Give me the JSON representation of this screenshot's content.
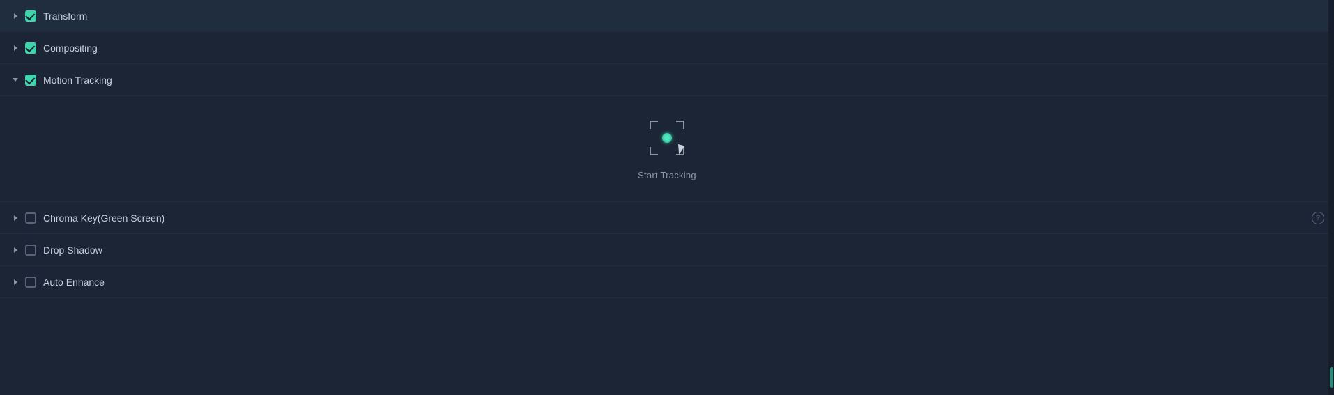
{
  "sections": [
    {
      "id": "transform",
      "label": "Transform",
      "checked": true,
      "expanded": false,
      "hasHelp": false
    },
    {
      "id": "compositing",
      "label": "Compositing",
      "checked": true,
      "expanded": false,
      "hasHelp": false
    },
    {
      "id": "motion-tracking",
      "label": "Motion Tracking",
      "checked": true,
      "expanded": true,
      "hasHelp": false
    },
    {
      "id": "chroma-key",
      "label": "Chroma Key(Green Screen)",
      "checked": false,
      "expanded": false,
      "hasHelp": true
    },
    {
      "id": "drop-shadow",
      "label": "Drop Shadow",
      "checked": false,
      "expanded": false,
      "hasHelp": false
    },
    {
      "id": "auto-enhance",
      "label": "Auto Enhance",
      "checked": false,
      "expanded": false,
      "hasHelp": false
    }
  ],
  "tracking": {
    "start_label": "Start Tracking"
  }
}
